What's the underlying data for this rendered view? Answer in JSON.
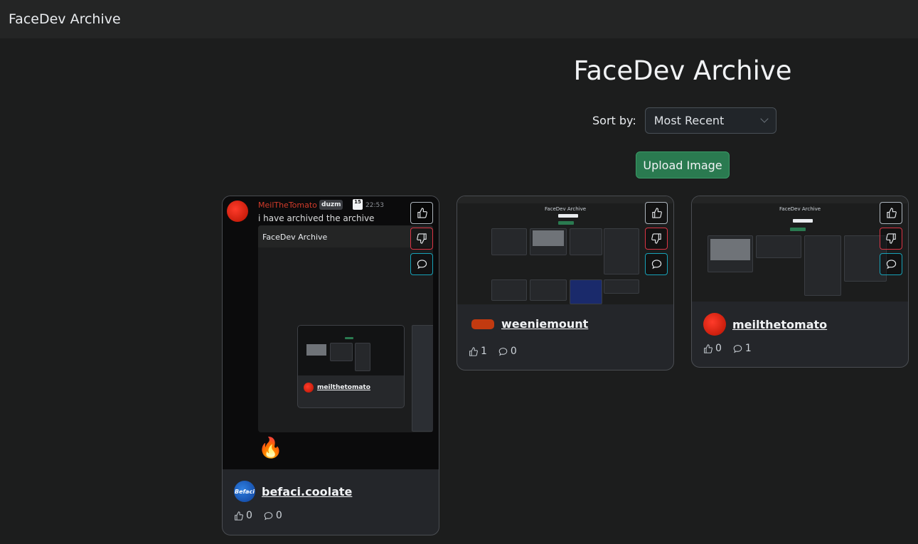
{
  "navbar": {
    "brand": "FaceDev Archive"
  },
  "header": {
    "title": "FaceDev Archive",
    "sort_label": "Sort by:",
    "sort_value": "Most Recent",
    "upload_label": "Upload Image"
  },
  "cards": [
    {
      "author": "befaci.coolate",
      "avatar_label": "Befaci",
      "likes": "0",
      "comments": "0",
      "screenshot": {
        "user": "MeilTheTomato",
        "tag": "duzm",
        "badge": "15",
        "time": "22:53",
        "message": "i have archived the archive",
        "embed_title": "FaceDev Archive",
        "embed_author": "meilthetomato",
        "reaction": "🔥"
      }
    },
    {
      "author": "weeniemount",
      "likes": "1",
      "comments": "0",
      "screenshot_title": "FaceDev Archive"
    },
    {
      "author": "meilthetomato",
      "likes": "0",
      "comments": "1",
      "screenshot_title": "FaceDev Archive"
    }
  ],
  "colors": {
    "background": "#1c1d1d",
    "navbar": "#242525",
    "card": "#24262a",
    "upload_button": "#2a7a50",
    "dislike_border": "#dc3545",
    "comment_border": "#17a2b8"
  },
  "icons": [
    "thumbs-up-icon",
    "thumbs-down-icon",
    "comment-icon",
    "chevron-down-icon"
  ]
}
